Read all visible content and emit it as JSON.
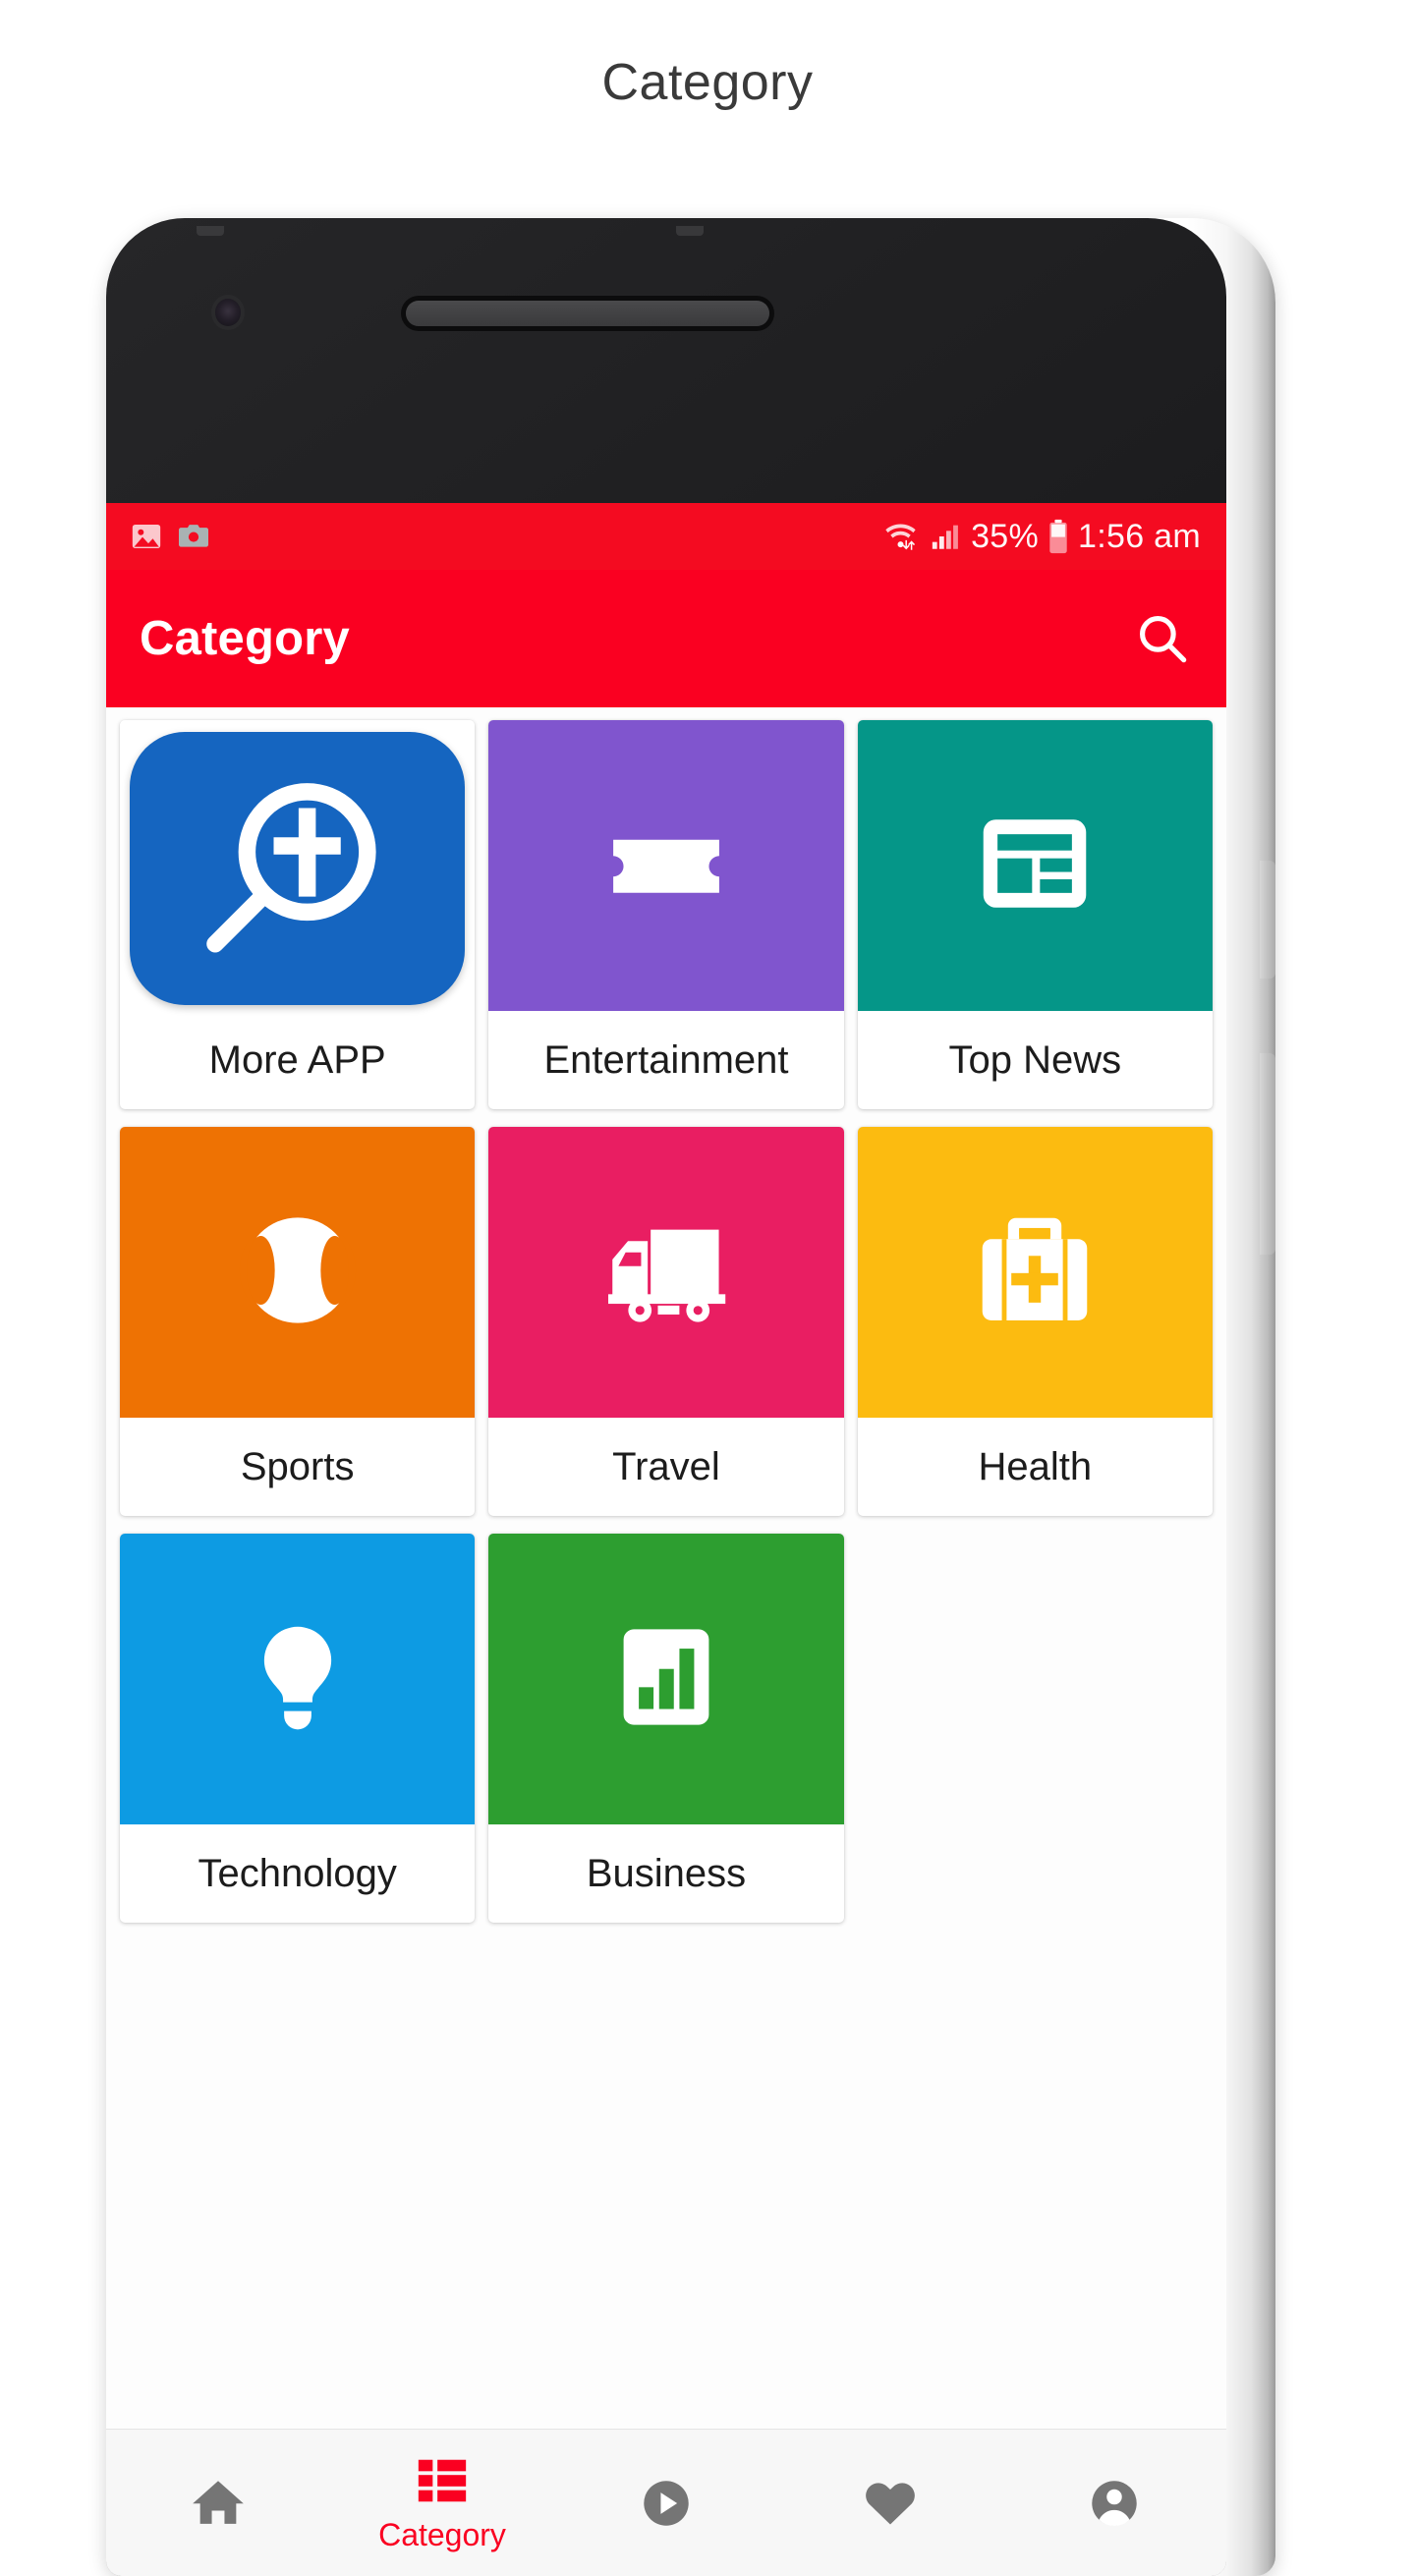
{
  "page": {
    "title": "Category"
  },
  "phone": {
    "status_bar": {
      "background": "#F40B21",
      "left_icons": [
        "image-icon",
        "camera-icon"
      ],
      "wifi_icon": "wifi-data-icon",
      "signal_icon": "cellular-signal-icon",
      "battery_percent": "35%",
      "battery_icon": "battery-icon",
      "time": "1:56 am"
    },
    "app_bar": {
      "background": "#FA0021",
      "title": "Category",
      "search_icon": "search-icon"
    },
    "categories": [
      {
        "label": "More APP",
        "color": "#1565C0",
        "icon": "magnifier-cross-icon",
        "style": "app-icon"
      },
      {
        "label": "Entertainment",
        "color": "#8055CE",
        "icon": "ticket-icon",
        "style": "tile"
      },
      {
        "label": "Top News",
        "color": "#059688",
        "icon": "newspaper-icon",
        "style": "tile"
      },
      {
        "label": "Sports",
        "color": "#EE7203",
        "icon": "baseball-icon",
        "style": "tile"
      },
      {
        "label": "Travel",
        "color": "#E91E62",
        "icon": "truck-icon",
        "style": "tile"
      },
      {
        "label": "Health",
        "color": "#FCBB10",
        "icon": "medical-kit-icon",
        "style": "tile"
      },
      {
        "label": "Technology",
        "color": "#0D9BE3",
        "icon": "lightbulb-icon",
        "style": "tile"
      },
      {
        "label": "Business",
        "color": "#2D9E30",
        "icon": "bar-chart-icon",
        "style": "tile"
      }
    ],
    "bottom_nav": {
      "active_color": "#FA0021",
      "inactive_color": "#757575",
      "items": [
        {
          "icon": "home-icon",
          "label": "",
          "active": false
        },
        {
          "icon": "category-icon",
          "label": "Category",
          "active": true
        },
        {
          "icon": "play-circle-icon",
          "label": "",
          "active": false
        },
        {
          "icon": "heart-icon",
          "label": "",
          "active": false
        },
        {
          "icon": "account-icon",
          "label": "",
          "active": false
        }
      ]
    }
  }
}
